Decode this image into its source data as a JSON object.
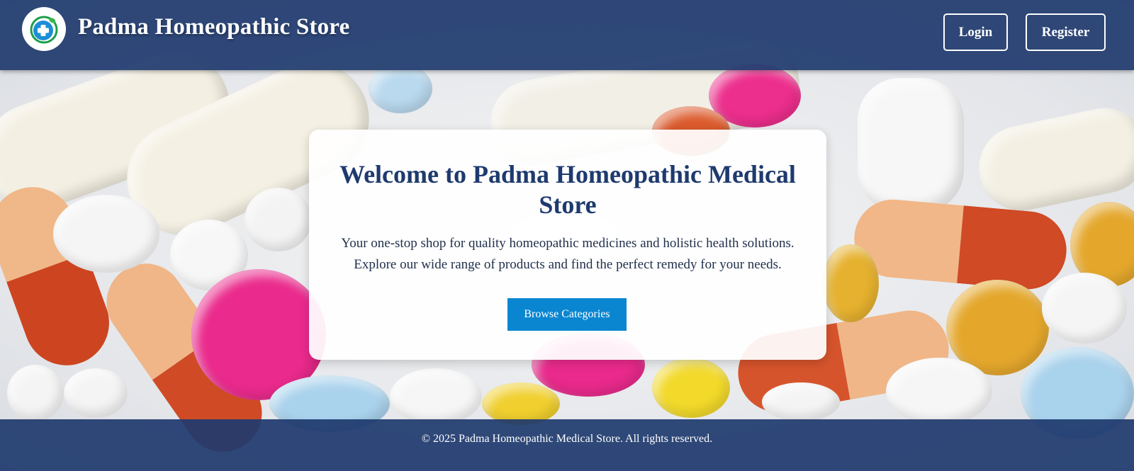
{
  "header": {
    "brand": "Padma Homeopathic Store",
    "login_label": "Login",
    "register_label": "Register",
    "logo_icon": "medical-cross-icon"
  },
  "hero": {
    "title": "Welcome to Padma Homeopathic Medical Store",
    "subtitle": "Your one-stop shop for quality homeopathic medicines and holistic health solutions. Explore our wide range of products and find the perfect remedy for your needs.",
    "cta_label": "Browse Categories"
  },
  "footer": {
    "copyright": "© 2025 Padma Homeopathic Medical Store. All rights reserved."
  },
  "colors": {
    "header_bg": "#1e3a6e",
    "title": "#1e3a6e",
    "cta_bg": "#0a86d1",
    "footer_bg": "#1e3a6e"
  }
}
